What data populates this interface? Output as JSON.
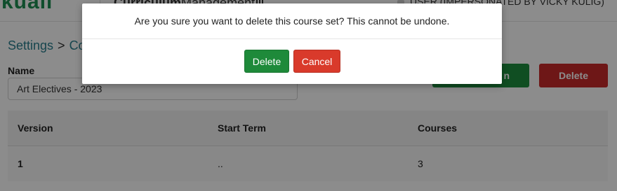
{
  "header": {
    "logo": "kuali",
    "app_title_bold": "Curriculum",
    "app_title_rest": "Management",
    "user_label": "USER (IMPERSONATED BY VICKY KULIG)"
  },
  "breadcrumb": {
    "root": "Settings",
    "separator": ">",
    "current": "Co"
  },
  "form": {
    "name_label": "Name",
    "name_value": "Art Electives - 2023"
  },
  "actions": {
    "save_label": "n",
    "delete_label": "Delete"
  },
  "table": {
    "headers": [
      "Version",
      "Start Term",
      "Courses"
    ],
    "rows": [
      [
        "1",
        "..",
        "3"
      ]
    ]
  },
  "modal": {
    "message": "Are you sure you want to delete this course set? This cannot be undone.",
    "confirm_label": "Delete",
    "cancel_label": "Cancel"
  },
  "colors": {
    "brand_green": "#1e8f52",
    "delete_green": "#1e8a3a",
    "cancel_red": "#d93a2b",
    "link_teal": "#2a7f8e"
  }
}
